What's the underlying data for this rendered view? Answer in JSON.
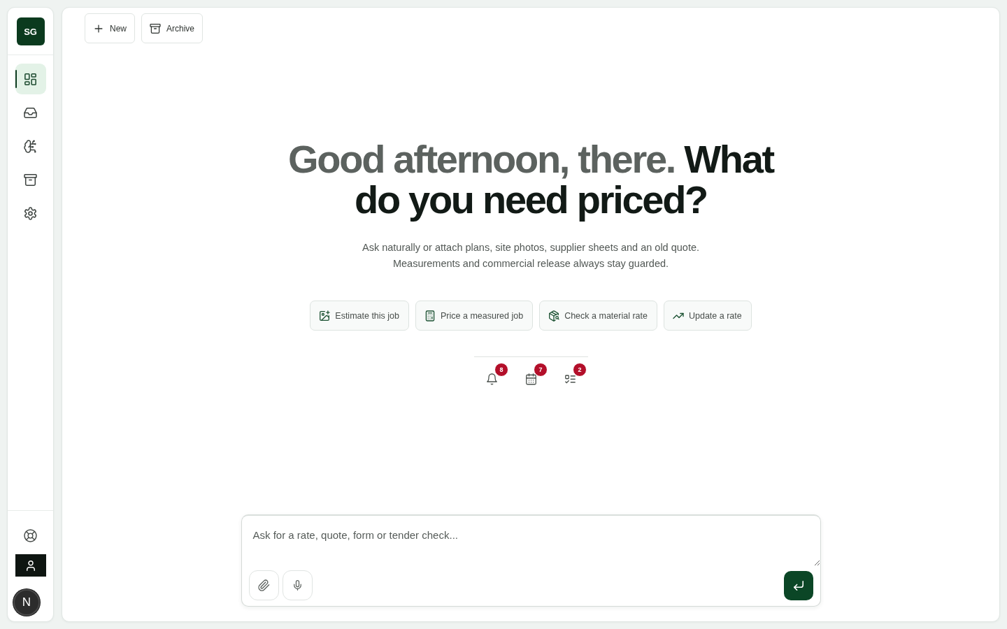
{
  "sidebar": {
    "logo": "SG",
    "nav_items": [
      {
        "selected": true
      },
      {
        "selected": false
      },
      {
        "selected": false
      },
      {
        "selected": false
      },
      {
        "selected": false
      }
    ]
  },
  "toolbar": {
    "buttons": [
      {
        "label": "New"
      },
      {
        "label": "Archive"
      }
    ]
  },
  "hero": {
    "heading": "Good afternoon, there. **What do you need priced?**",
    "subtitle": "Ask naturally or attach plans, site photos, supplier sheets and an old quote. Measurements and commercial release always stay guarded."
  },
  "suggestions": [
    {
      "label": "Estimate this job"
    },
    {
      "label": "Price a measured job"
    },
    {
      "label": "Check a material rate"
    },
    {
      "label": "Update a rate"
    }
  ],
  "indicators": [
    {
      "count": "8"
    },
    {
      "count": "7"
    },
    {
      "count": "2"
    }
  ],
  "composer": {
    "placeholder": "Ask for a rate, quote, form or tender check..."
  },
  "dev_indicator": {
    "label": "N"
  }
}
